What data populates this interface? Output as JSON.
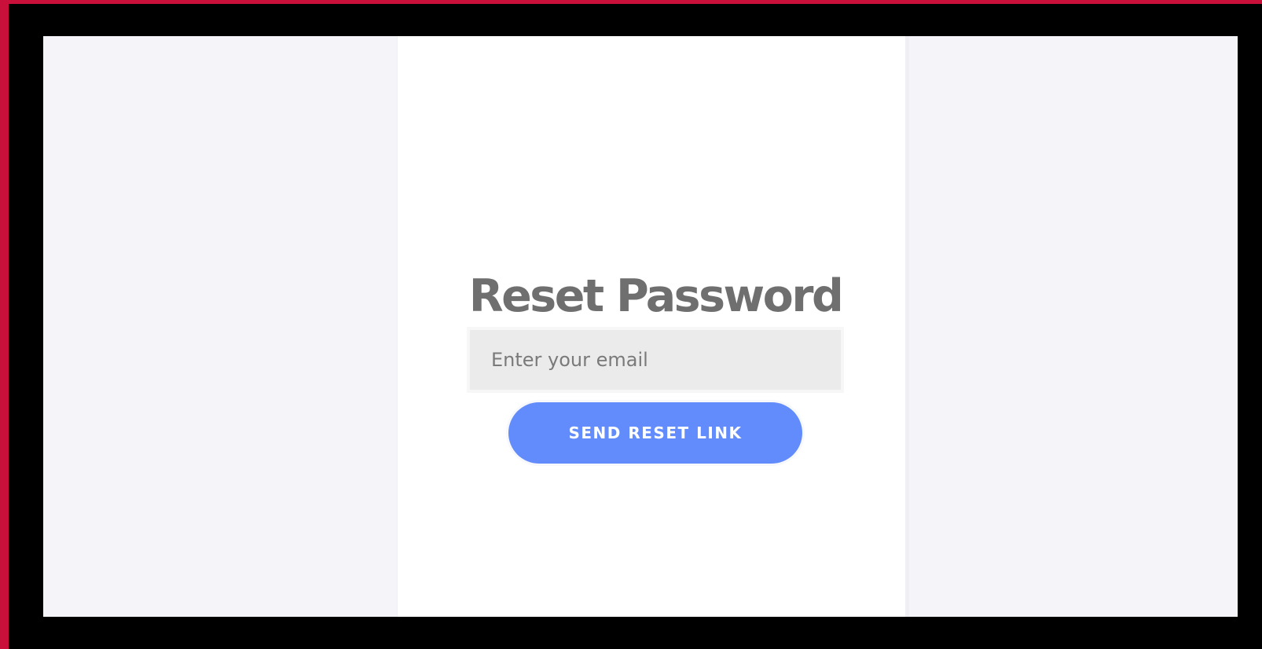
{
  "page": {
    "title": "Reset Password"
  },
  "form": {
    "email_placeholder": "Enter your email",
    "email_value": "",
    "submit_label": "SEND RESET LINK"
  },
  "colors": {
    "accent_frame": "#c8103a",
    "page_background": "#f4f4f9",
    "card_background": "#ffffff",
    "title_text": "#6f6f6f",
    "input_background": "#ebebeb",
    "button_background": "#628cfc",
    "button_text": "#ffffff"
  }
}
